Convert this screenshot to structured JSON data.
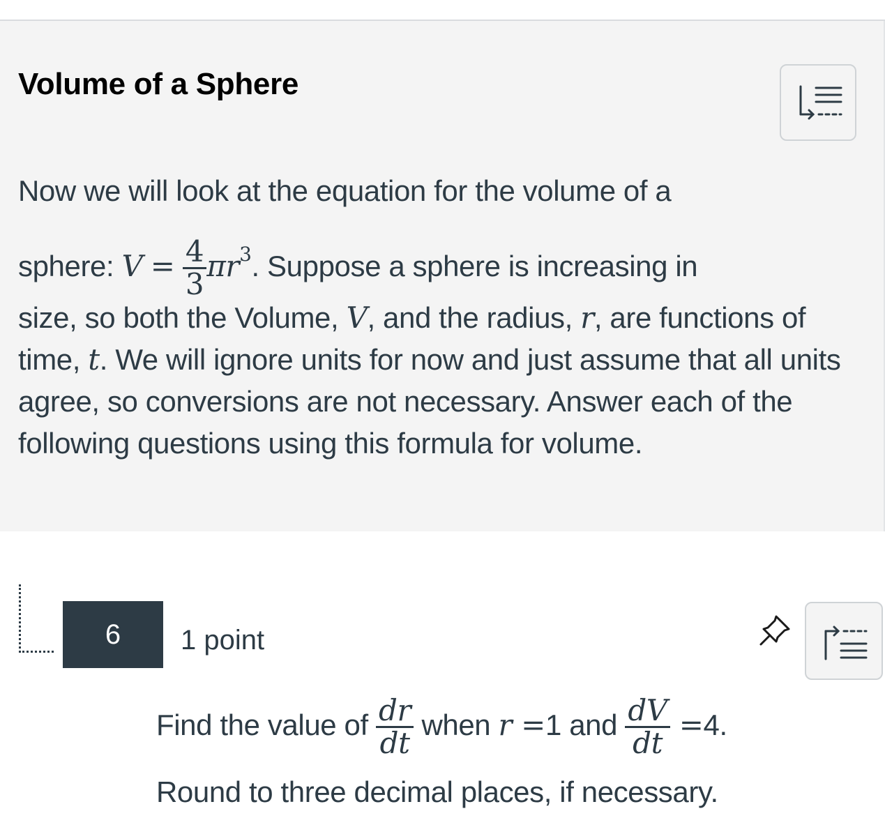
{
  "stimulus": {
    "title": "Volume of a Sphere",
    "collapse_icon": "collapse-list-icon",
    "para1_a": "Now we will look at the equation for the volume of a",
    "para1_b": "sphere: ",
    "eq_V": "V",
    "eq_equals": "=",
    "eq_num": "4",
    "eq_den": "3",
    "eq_pi_r": "πr",
    "eq_exp": "3",
    "para1_c": ". Suppose a sphere is increasing in",
    "para2_a": "size, so both the Volume, ",
    "para2_V": "V",
    "para2_b": ", and the radius, ",
    "para2_r": "r",
    "para2_c": ", are functions of time, ",
    "para2_t": "t",
    "para2_d": ". We will ignore units for now and just assume that all units agree, so conversions are not necessary. Answer each of the following questions using this formula for volume."
  },
  "question": {
    "number": "6",
    "points": "1 point",
    "pin_icon": "pin-icon",
    "nav_icon": "expand-list-icon",
    "text_a": "Find the value of ",
    "frac1_num": "dr",
    "frac1_den": "dt",
    "text_b": " when ",
    "var_r": "r",
    "text_eq": " =",
    "val_r": "1",
    "text_and": " and ",
    "frac2_num": "dV",
    "frac2_den": "dt",
    "text_eq2": " =",
    "val_dv": "4.",
    "instructions": "Round to three decimal places, if necessary."
  },
  "colors": {
    "text": "#2d3b45",
    "stimulus_bg": "#f4f4f4",
    "number_bg": "#2d3b45"
  }
}
